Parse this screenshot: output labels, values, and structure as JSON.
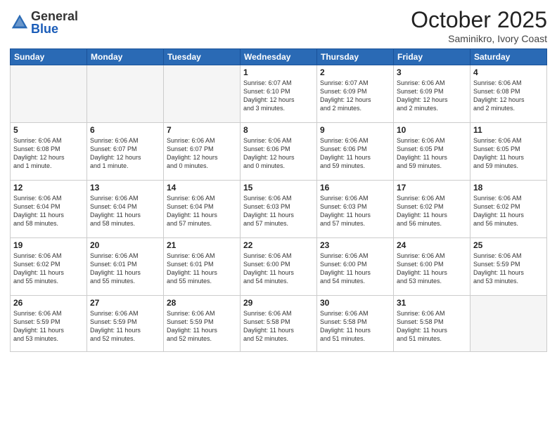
{
  "logo": {
    "general": "General",
    "blue": "Blue"
  },
  "title": "October 2025",
  "location": "Saminikro, Ivory Coast",
  "headers": [
    "Sunday",
    "Monday",
    "Tuesday",
    "Wednesday",
    "Thursday",
    "Friday",
    "Saturday"
  ],
  "weeks": [
    [
      {
        "day": "",
        "empty": true
      },
      {
        "day": "",
        "empty": true
      },
      {
        "day": "",
        "empty": true
      },
      {
        "day": "1",
        "info": "Sunrise: 6:07 AM\nSunset: 6:10 PM\nDaylight: 12 hours\nand 3 minutes."
      },
      {
        "day": "2",
        "info": "Sunrise: 6:07 AM\nSunset: 6:09 PM\nDaylight: 12 hours\nand 2 minutes."
      },
      {
        "day": "3",
        "info": "Sunrise: 6:06 AM\nSunset: 6:09 PM\nDaylight: 12 hours\nand 2 minutes."
      },
      {
        "day": "4",
        "info": "Sunrise: 6:06 AM\nSunset: 6:08 PM\nDaylight: 12 hours\nand 2 minutes."
      }
    ],
    [
      {
        "day": "5",
        "info": "Sunrise: 6:06 AM\nSunset: 6:08 PM\nDaylight: 12 hours\nand 1 minute."
      },
      {
        "day": "6",
        "info": "Sunrise: 6:06 AM\nSunset: 6:07 PM\nDaylight: 12 hours\nand 1 minute."
      },
      {
        "day": "7",
        "info": "Sunrise: 6:06 AM\nSunset: 6:07 PM\nDaylight: 12 hours\nand 0 minutes."
      },
      {
        "day": "8",
        "info": "Sunrise: 6:06 AM\nSunset: 6:06 PM\nDaylight: 12 hours\nand 0 minutes."
      },
      {
        "day": "9",
        "info": "Sunrise: 6:06 AM\nSunset: 6:06 PM\nDaylight: 11 hours\nand 59 minutes."
      },
      {
        "day": "10",
        "info": "Sunrise: 6:06 AM\nSunset: 6:05 PM\nDaylight: 11 hours\nand 59 minutes."
      },
      {
        "day": "11",
        "info": "Sunrise: 6:06 AM\nSunset: 6:05 PM\nDaylight: 11 hours\nand 59 minutes."
      }
    ],
    [
      {
        "day": "12",
        "info": "Sunrise: 6:06 AM\nSunset: 6:04 PM\nDaylight: 11 hours\nand 58 minutes."
      },
      {
        "day": "13",
        "info": "Sunrise: 6:06 AM\nSunset: 6:04 PM\nDaylight: 11 hours\nand 58 minutes."
      },
      {
        "day": "14",
        "info": "Sunrise: 6:06 AM\nSunset: 6:04 PM\nDaylight: 11 hours\nand 57 minutes."
      },
      {
        "day": "15",
        "info": "Sunrise: 6:06 AM\nSunset: 6:03 PM\nDaylight: 11 hours\nand 57 minutes."
      },
      {
        "day": "16",
        "info": "Sunrise: 6:06 AM\nSunset: 6:03 PM\nDaylight: 11 hours\nand 57 minutes."
      },
      {
        "day": "17",
        "info": "Sunrise: 6:06 AM\nSunset: 6:02 PM\nDaylight: 11 hours\nand 56 minutes."
      },
      {
        "day": "18",
        "info": "Sunrise: 6:06 AM\nSunset: 6:02 PM\nDaylight: 11 hours\nand 56 minutes."
      }
    ],
    [
      {
        "day": "19",
        "info": "Sunrise: 6:06 AM\nSunset: 6:02 PM\nDaylight: 11 hours\nand 55 minutes."
      },
      {
        "day": "20",
        "info": "Sunrise: 6:06 AM\nSunset: 6:01 PM\nDaylight: 11 hours\nand 55 minutes."
      },
      {
        "day": "21",
        "info": "Sunrise: 6:06 AM\nSunset: 6:01 PM\nDaylight: 11 hours\nand 55 minutes."
      },
      {
        "day": "22",
        "info": "Sunrise: 6:06 AM\nSunset: 6:00 PM\nDaylight: 11 hours\nand 54 minutes."
      },
      {
        "day": "23",
        "info": "Sunrise: 6:06 AM\nSunset: 6:00 PM\nDaylight: 11 hours\nand 54 minutes."
      },
      {
        "day": "24",
        "info": "Sunrise: 6:06 AM\nSunset: 6:00 PM\nDaylight: 11 hours\nand 53 minutes."
      },
      {
        "day": "25",
        "info": "Sunrise: 6:06 AM\nSunset: 5:59 PM\nDaylight: 11 hours\nand 53 minutes."
      }
    ],
    [
      {
        "day": "26",
        "info": "Sunrise: 6:06 AM\nSunset: 5:59 PM\nDaylight: 11 hours\nand 53 minutes."
      },
      {
        "day": "27",
        "info": "Sunrise: 6:06 AM\nSunset: 5:59 PM\nDaylight: 11 hours\nand 52 minutes."
      },
      {
        "day": "28",
        "info": "Sunrise: 6:06 AM\nSunset: 5:59 PM\nDaylight: 11 hours\nand 52 minutes."
      },
      {
        "day": "29",
        "info": "Sunrise: 6:06 AM\nSunset: 5:58 PM\nDaylight: 11 hours\nand 52 minutes."
      },
      {
        "day": "30",
        "info": "Sunrise: 6:06 AM\nSunset: 5:58 PM\nDaylight: 11 hours\nand 51 minutes."
      },
      {
        "day": "31",
        "info": "Sunrise: 6:06 AM\nSunset: 5:58 PM\nDaylight: 11 hours\nand 51 minutes."
      },
      {
        "day": "",
        "empty": true
      }
    ]
  ]
}
